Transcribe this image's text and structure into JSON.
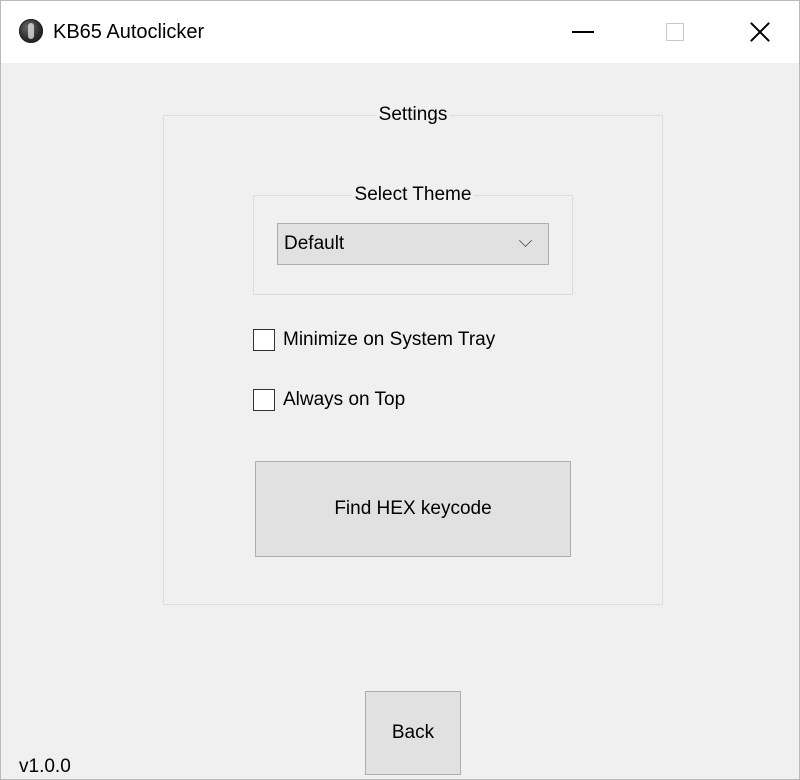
{
  "window": {
    "title": "KB65 Autoclicker",
    "icon": "app-globe-icon"
  },
  "titlebar_controls": {
    "minimize_icon": "minimize-icon",
    "maximize_icon": "maximize-icon",
    "close_icon": "close-icon"
  },
  "settings": {
    "group_title": "Settings",
    "theme": {
      "group_title": "Select Theme",
      "selected": "Default"
    },
    "checkboxes": [
      {
        "label": "Minimize on System Tray",
        "checked": false
      },
      {
        "label": "Always on Top",
        "checked": false
      }
    ],
    "find_hex_button": "Find HEX keycode"
  },
  "back_button": "Back",
  "version": "v1.0.0",
  "colors": {
    "background": "#f0f0f0",
    "titlebar": "#ffffff",
    "button_face": "#e1e1e1",
    "button_border": "#adadad",
    "group_border": "#dcdcdc"
  }
}
